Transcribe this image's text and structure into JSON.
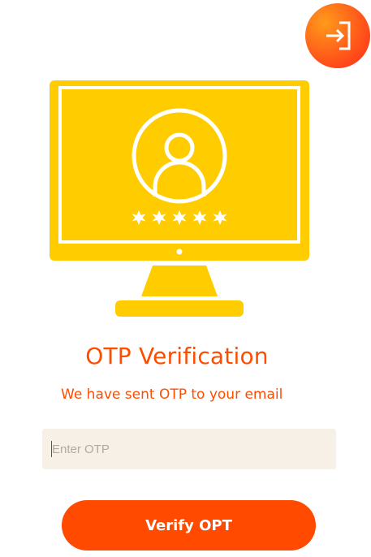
{
  "header": {
    "logout_icon": "logout-arrow-icon"
  },
  "illustration": {
    "icon": "monitor-user-password-icon",
    "password_mask": "*****",
    "color": "#ffcc00"
  },
  "main": {
    "title": "OTP Verification",
    "subtitle": "We have sent OTP to your email",
    "otp_placeholder": "Enter OTP",
    "otp_value": "",
    "verify_label": "Verify OPT"
  },
  "colors": {
    "accent": "#ff4a00",
    "input_bg": "#f7f0e6",
    "illustration": "#ffcc00"
  }
}
